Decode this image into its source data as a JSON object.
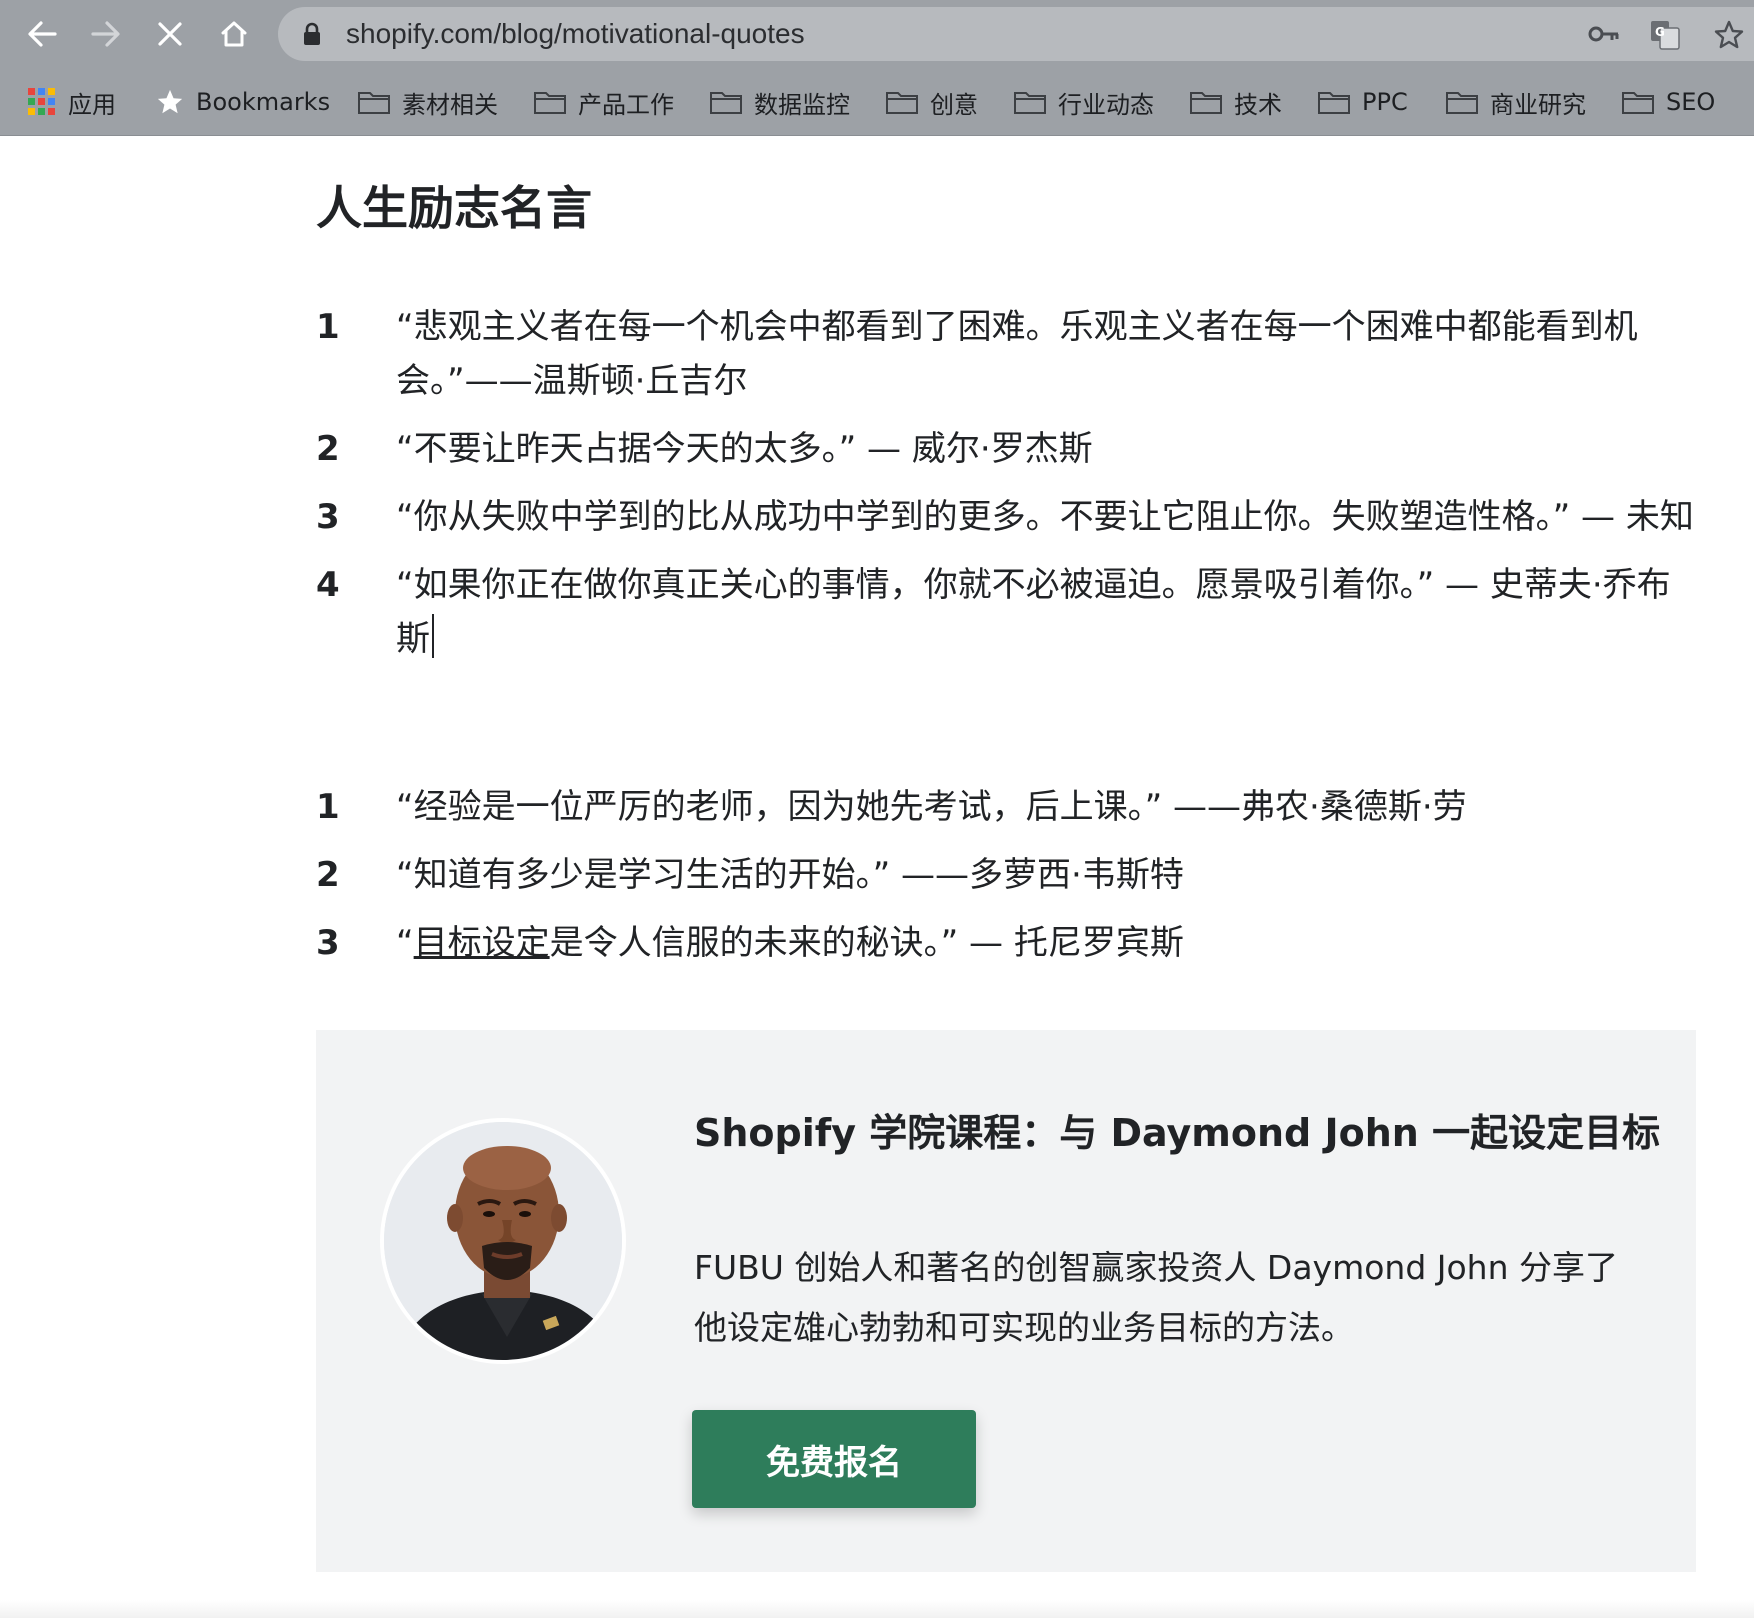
{
  "browser": {
    "url": "shopify.com/blog/motivational-quotes",
    "icons": [
      "back-arrow-icon",
      "forward-arrow-icon",
      "stop-loading-icon",
      "home-icon",
      "lock-icon",
      "key-icon",
      "translate-icon",
      "star-icon"
    ]
  },
  "bookmarks": [
    {
      "label": "应用",
      "icon": "apps-grid-icon"
    },
    {
      "label": "Bookmarks",
      "icon": "star-icon"
    },
    {
      "label": "素材相关",
      "icon": "folder-icon"
    },
    {
      "label": "产品工作",
      "icon": "folder-icon"
    },
    {
      "label": "数据监控",
      "icon": "folder-icon"
    },
    {
      "label": "创意",
      "icon": "folder-icon"
    },
    {
      "label": "行业动态",
      "icon": "folder-icon"
    },
    {
      "label": "技术",
      "icon": "folder-icon"
    },
    {
      "label": "PPC",
      "icon": "folder-icon"
    },
    {
      "label": "商业研究",
      "icon": "folder-icon"
    },
    {
      "label": "SEO",
      "icon": "folder-icon"
    }
  ],
  "article": {
    "heading": "人生励志名言",
    "list1": [
      {
        "num": "1",
        "text": "“悲观主义者在每一个机会中都看到了困难。乐观主义者在每一个困难中都能看到机会。”——温斯顿·丘吉尔"
      },
      {
        "num": "2",
        "text": "“不要让昨天占据今天的太多。” — 威尔·罗杰斯"
      },
      {
        "num": "3",
        "text": "“你从失败中学到的比从成功中学到的更多。不要让它阻止你。失败塑造性格。” — 未知"
      },
      {
        "num": "4",
        "text": "“如果你正在做你真正关心的事情，你就不必被逼迫。愿景吸引着你。” — 史蒂夫·乔布斯"
      }
    ],
    "list2": [
      {
        "num": "1",
        "text": "“经验是一位严厉的老师，因为她先考试，后上课。” ——弗农·桑德斯·劳"
      },
      {
        "num": "2",
        "text": "“知道有多少是学习生活的开始。” ——多萝西·韦斯特"
      },
      {
        "num": "3",
        "open_quote": "“",
        "link_text": "目标设定",
        "rest": "是令人信服的未来的秘诀。” — 托尼罗宾斯"
      }
    ]
  },
  "promo": {
    "title": "Shopify 学院课程：与 Daymond John 一起设定目标",
    "description": "FUBU 创始人和著名的创智赢家投资人 Daymond John 分享了他设定雄心勃勃和可实现的业务目标的方法。",
    "button_label": "免费报名",
    "button_color": "#2e7d5b",
    "avatar_icon": "portrait-avatar"
  }
}
